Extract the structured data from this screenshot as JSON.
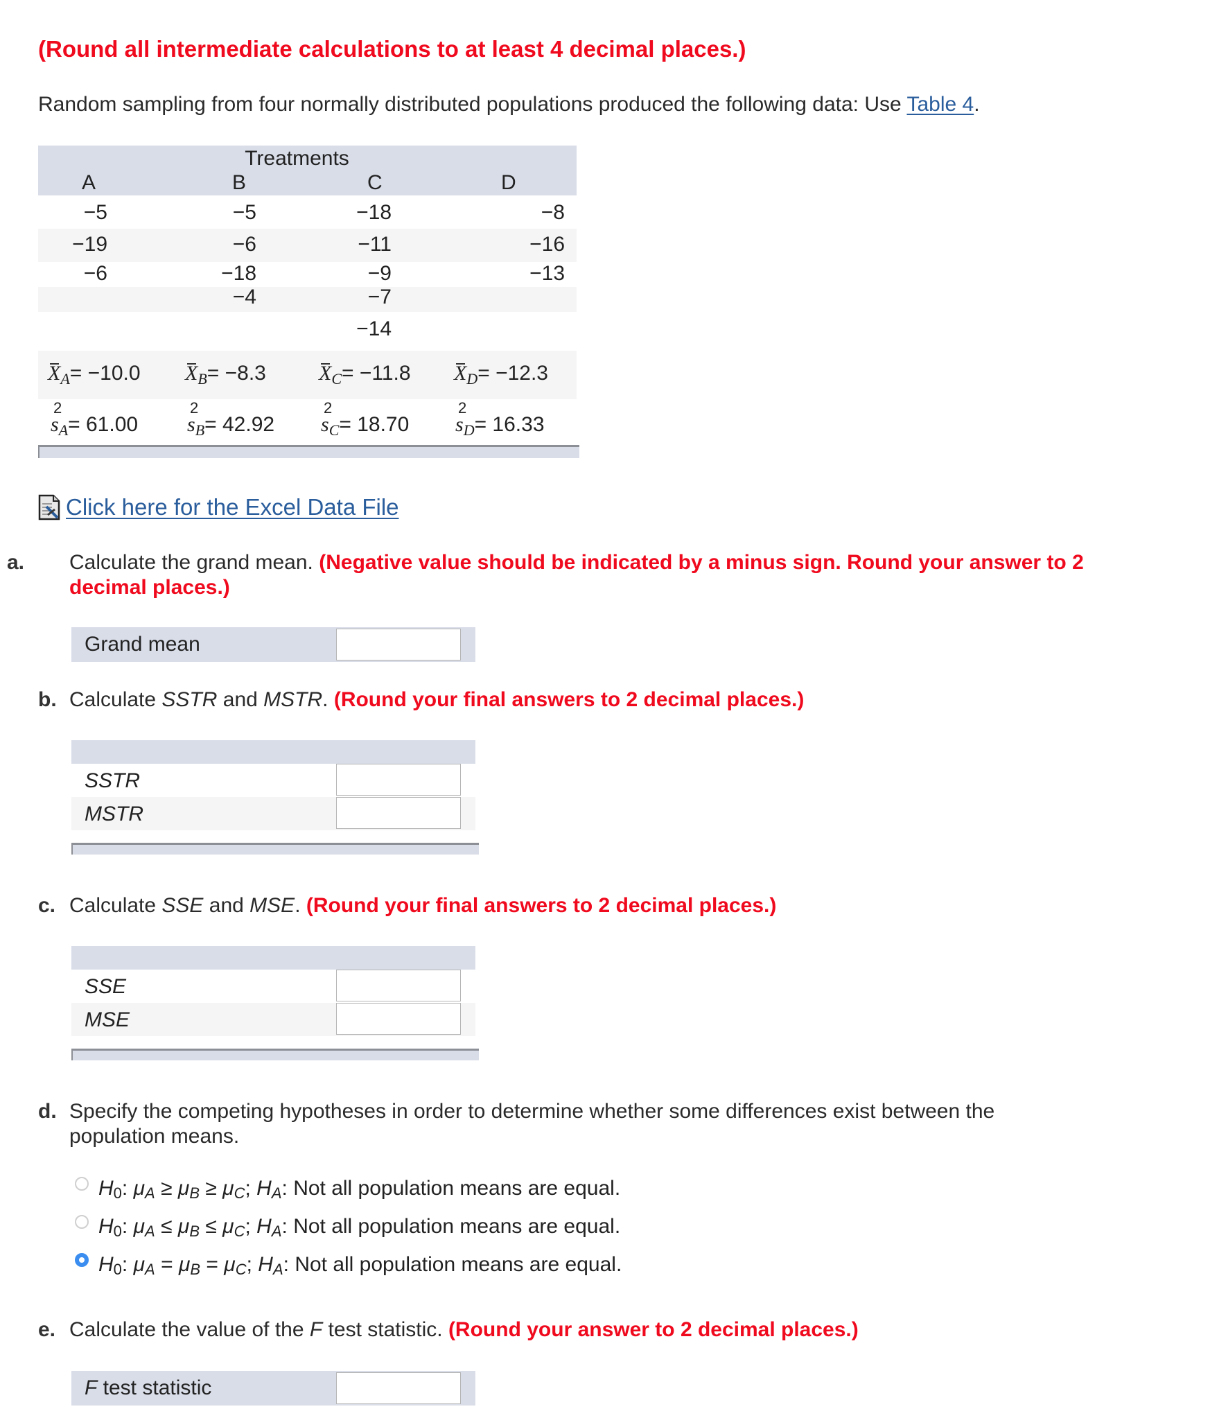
{
  "instructions": {
    "round_note": "(Round all intermediate calculations to at least 4 decimal places.)",
    "intro_text": "Random sampling from four normally distributed populations produced the following data: Use ",
    "table_link": "Table 4",
    "intro_end": "."
  },
  "data_table": {
    "group_header": "Treatments",
    "columns": [
      "A",
      "B",
      "C",
      "D"
    ],
    "rows": [
      [
        "−5",
        "−5",
        "−18",
        "−8"
      ],
      [
        "−19",
        "−6",
        "−11",
        "−16"
      ],
      [
        "−6",
        "−18",
        "−9",
        "−13"
      ],
      [
        "",
        "−4",
        "−7",
        ""
      ],
      [
        "",
        "",
        "−14",
        ""
      ]
    ],
    "means": [
      {
        "symbol": "X",
        "sub": "A",
        "value": "= −10.0"
      },
      {
        "symbol": "X",
        "sub": "B",
        "value": "= −8.3"
      },
      {
        "symbol": "X",
        "sub": "C",
        "value": "= −11.8"
      },
      {
        "symbol": "X",
        "sub": "D",
        "value": "= −12.3"
      }
    ],
    "variances": [
      {
        "symbol": "s",
        "sup": "2",
        "sub": "A",
        "value": "= 61.00"
      },
      {
        "symbol": "s",
        "sup": "2",
        "sub": "B",
        "value": "= 42.92"
      },
      {
        "symbol": "s",
        "sup": "2",
        "sub": "C",
        "value": "= 18.70"
      },
      {
        "symbol": "s",
        "sup": "2",
        "sub": "D",
        "value": "= 16.33"
      }
    ]
  },
  "excel_link": {
    "icon": "excel-file-icon",
    "label": "Click here for the Excel Data File"
  },
  "questions": {
    "a": {
      "label": "a.",
      "text": "Calculate the grand mean. ",
      "note": "(Negative value should be indicated by a minus sign. Round your answer to 2 decimal places.)",
      "fields": [
        {
          "label": "Grand mean",
          "value": ""
        }
      ]
    },
    "b": {
      "label": "b.",
      "text_1": "Calculate ",
      "term_1": "SSTR",
      "text_2": " and ",
      "term_2": "MSTR",
      "text_3": ". ",
      "note": "(Round your final answers to 2 decimal places.)",
      "fields": [
        {
          "label": "SSTR",
          "value": ""
        },
        {
          "label": "MSTR",
          "value": ""
        }
      ]
    },
    "c": {
      "label": "c.",
      "text_1": "Calculate ",
      "term_1": "SSE",
      "text_2": " and ",
      "term_2": "MSE",
      "text_3": ". ",
      "note": "(Round your final answers to 2 decimal places.)",
      "fields": [
        {
          "label": "SSE",
          "value": ""
        },
        {
          "label": "MSE",
          "value": ""
        }
      ]
    },
    "d": {
      "label": "d.",
      "text": "Specify the competing hypotheses in order to determine whether some differences exist between the population means.",
      "options": [
        {
          "op": "≥",
          "ha": "Not all population means are equal.",
          "checked": false
        },
        {
          "op": "≤",
          "ha": "Not all population means are equal.",
          "checked": false
        },
        {
          "op": "=",
          "ha": "Not all population means are equal.",
          "checked": true
        }
      ],
      "h0": "H",
      "h0_sub": "0",
      "mu": "μ",
      "ha": "H",
      "ha_sub": "A",
      "subs": [
        "A",
        "B",
        "C"
      ]
    },
    "e": {
      "label": "e.",
      "text_1": "Calculate the value of the ",
      "term": "F",
      "text_2": " test statistic. ",
      "note": "(Round your answer to 2 decimal places.)",
      "field_term": "F",
      "field_rest": " test statistic",
      "value": ""
    }
  },
  "colors": {
    "warning_red": "#f00a1e",
    "link_blue": "#2a5d9c",
    "table_header": "#d9dde8",
    "row_alt": "#f5f5f5",
    "radio_selected": "#3b8ef0"
  }
}
